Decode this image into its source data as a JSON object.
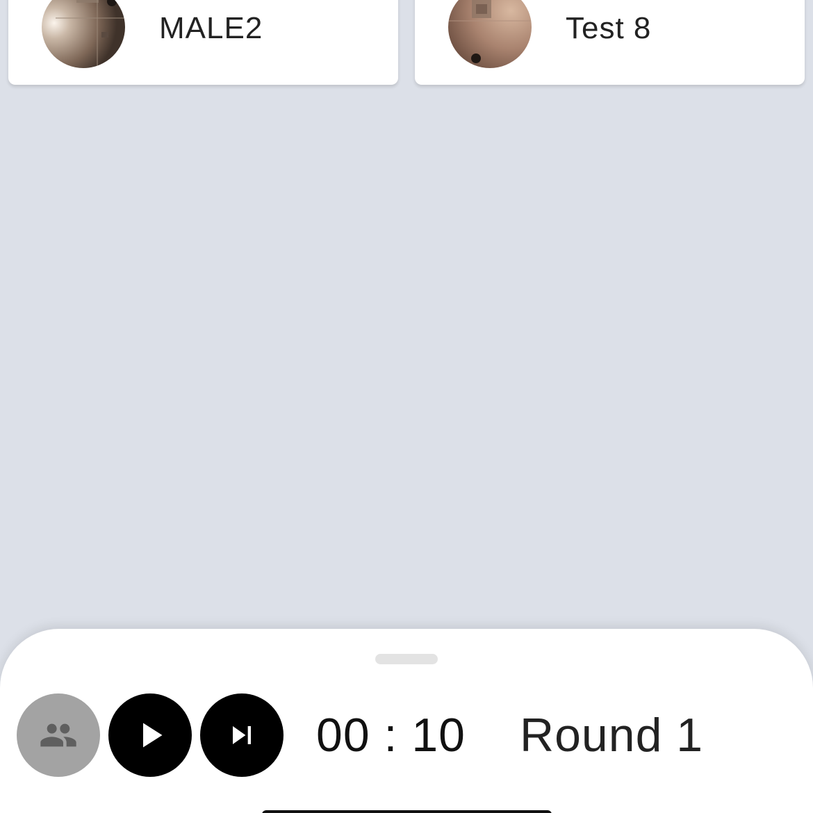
{
  "participants": [
    {
      "name": "MALE2"
    },
    {
      "name": "Test 8"
    }
  ],
  "controls": {
    "group_icon": "group-icon",
    "play_icon": "play-icon",
    "skip_icon": "skip-next-icon"
  },
  "timer": {
    "text": "00 : 10"
  },
  "round": {
    "text": "Round 1"
  },
  "colors": {
    "background": "#dce0e8",
    "card": "#ffffff",
    "button_dark": "#000000",
    "button_disabled": "#a3a3a3"
  }
}
